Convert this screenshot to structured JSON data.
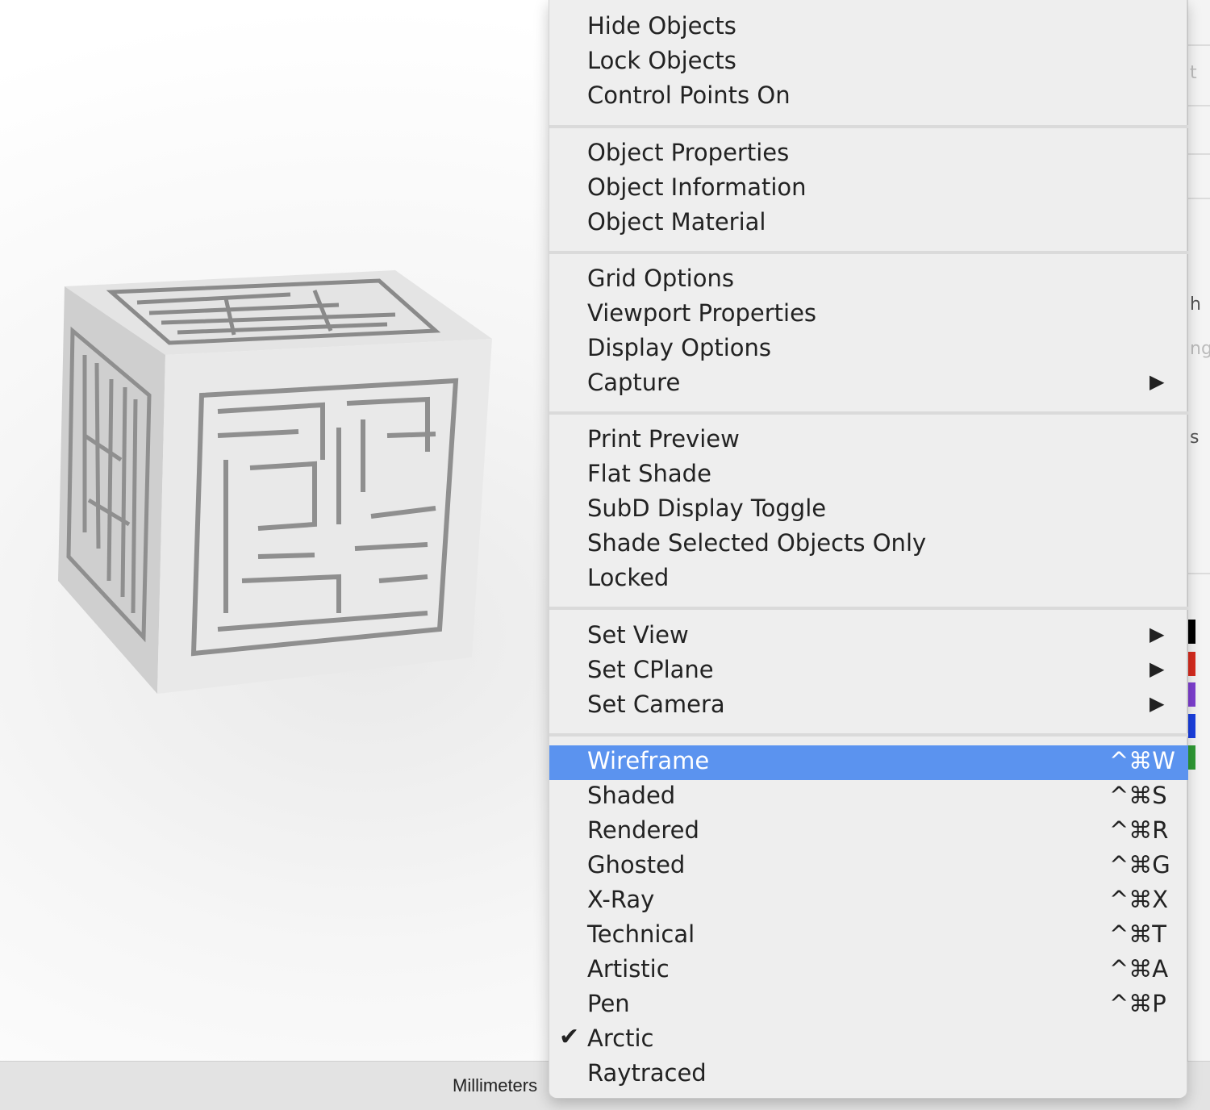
{
  "status_bar": {
    "units": "Millimeters"
  },
  "right_panel": {
    "fragments": [
      "t",
      "h",
      "ng",
      "s"
    ],
    "swatch_colors": [
      "#000000",
      "#d62b1e",
      "#7e3fd0",
      "#1a3fe0",
      "#2f9a35"
    ]
  },
  "menu": {
    "highlight_color": "#5b93ef",
    "items": [
      {
        "label": "Hide Objects"
      },
      {
        "label": "Lock Objects"
      },
      {
        "label": "Control Points On"
      },
      {
        "label": "Object Properties"
      },
      {
        "label": "Object Information"
      },
      {
        "label": "Object Material"
      },
      {
        "label": "Grid Options"
      },
      {
        "label": "Viewport Properties"
      },
      {
        "label": "Display Options"
      },
      {
        "label": "Capture",
        "submenu_icon": "triangle-right-icon"
      },
      {
        "label": "Print Preview"
      },
      {
        "label": "Flat Shade"
      },
      {
        "label": "SubD Display Toggle"
      },
      {
        "label": "Shade Selected Objects Only"
      },
      {
        "label": "Locked"
      },
      {
        "label": "Set View",
        "submenu_icon": "triangle-right-icon"
      },
      {
        "label": "Set CPlane",
        "submenu_icon": "triangle-right-icon"
      },
      {
        "label": "Set Camera",
        "submenu_icon": "triangle-right-icon"
      },
      {
        "label": "Wireframe",
        "shortcut": "^⌘W",
        "highlighted": true
      },
      {
        "label": "Shaded",
        "shortcut": "^⌘S"
      },
      {
        "label": "Rendered",
        "shortcut": "^⌘R"
      },
      {
        "label": "Ghosted",
        "shortcut": "^⌘G"
      },
      {
        "label": "X-Ray",
        "shortcut": "^⌘X"
      },
      {
        "label": "Technical",
        "shortcut": "^⌘T"
      },
      {
        "label": "Artistic",
        "shortcut": "^⌘A"
      },
      {
        "label": "Pen",
        "shortcut": "^⌘P"
      },
      {
        "label": "Arctic",
        "checked": true,
        "check_icon": "checkmark-icon"
      },
      {
        "label": "Raytraced"
      }
    ]
  }
}
